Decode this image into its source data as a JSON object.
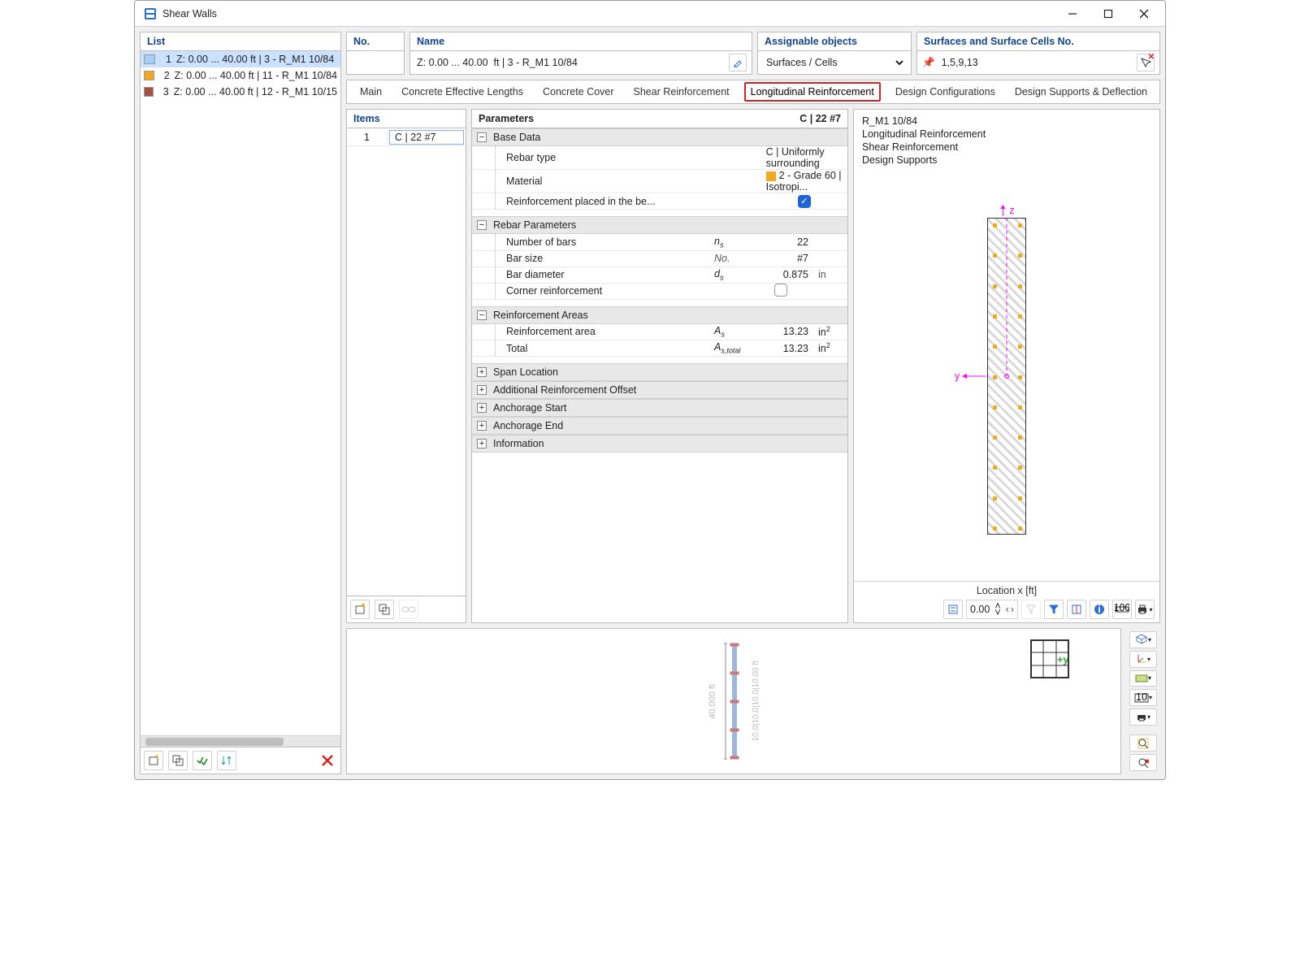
{
  "window_title": "Shear Walls",
  "list": {
    "heading": "List",
    "items": [
      {
        "idx": "1",
        "swatch": "#a7cff3",
        "label": "Z: 0.00 ... 40.00 ft | 3 - R_M1 10/84",
        "selected": true
      },
      {
        "idx": "2",
        "swatch": "#f0a821",
        "label": "Z: 0.00 ... 40.00 ft | 11 - R_M1 10/84",
        "selected": false
      },
      {
        "idx": "3",
        "swatch": "#a15242",
        "label": "Z: 0.00 ... 40.00 ft | 12 - R_M1 10/15",
        "selected": false
      }
    ]
  },
  "head": {
    "no_label": "No.",
    "no_value": "",
    "name_label": "Name",
    "name_value": "Z: 0.00 ... 40.00  ft | 3 - R_M1 10/84",
    "assign_label": "Assignable objects",
    "assign_value": "Surfaces / Cells",
    "surf_label": "Surfaces and Surface Cells No.",
    "surf_value": "1,5,9,13"
  },
  "tabs": [
    "Main",
    "Concrete Effective Lengths",
    "Concrete Cover",
    "Shear Reinforcement",
    "Longitudinal Reinforcement",
    "Design Configurations",
    "Design Supports & Deflection"
  ],
  "active_tab": "Longitudinal Reinforcement",
  "items_pane": {
    "heading": "Items",
    "rows": [
      {
        "idx": "1",
        "val": "C | 22 #7"
      }
    ]
  },
  "params": {
    "heading": "Parameters",
    "heading_right": "C | 22 #7",
    "groups": {
      "base": {
        "title": "Base Data",
        "rebar_type_label": "Rebar type",
        "rebar_type_value": "C | Uniformly surrounding",
        "material_label": "Material",
        "material_value": "2 - Grade 60 | Isotropi...",
        "rein_placed_label": "Reinforcement placed in the be...",
        "rein_placed_checked": true
      },
      "rebar": {
        "title": "Rebar Parameters",
        "nbars_label": "Number of bars",
        "nbars_sym": "n",
        "nbars_sub": "s",
        "nbars_val": "22",
        "bsize_label": "Bar size",
        "bsize_sym": "No.",
        "bsize_val": "#7",
        "bdiam_label": "Bar diameter",
        "bdiam_sym": "d",
        "bdiam_sub": "s",
        "bdiam_val": "0.875",
        "bdiam_unit": "in",
        "corner_label": "Corner reinforcement",
        "corner_checked": false
      },
      "areas": {
        "title": "Reinforcement Areas",
        "area_label": "Reinforcement area",
        "area_sym": "A",
        "area_sub": "s",
        "area_val": "13.23",
        "area_unit": "in²",
        "total_label": "Total",
        "total_sym": "A",
        "total_sub": "s,total",
        "total_val": "13.23",
        "total_unit": "in²"
      }
    },
    "collapsed": [
      "Span Location",
      "Additional Reinforcement Offset",
      "Anchorage Start",
      "Anchorage End",
      "Information"
    ]
  },
  "preview": {
    "lines": [
      "R_M1 10/84",
      "Longitudinal Reinforcement",
      "Shear Reinforcement",
      "Design Supports"
    ],
    "axis_z": "z",
    "axis_y": "y",
    "location_label": "Location x [ft]",
    "location_value": "0.00"
  },
  "bottom": {
    "height_label": "40.000 ft",
    "spans": "10.0|10.0|10.0|10.00 ft",
    "nav_y": "y"
  }
}
